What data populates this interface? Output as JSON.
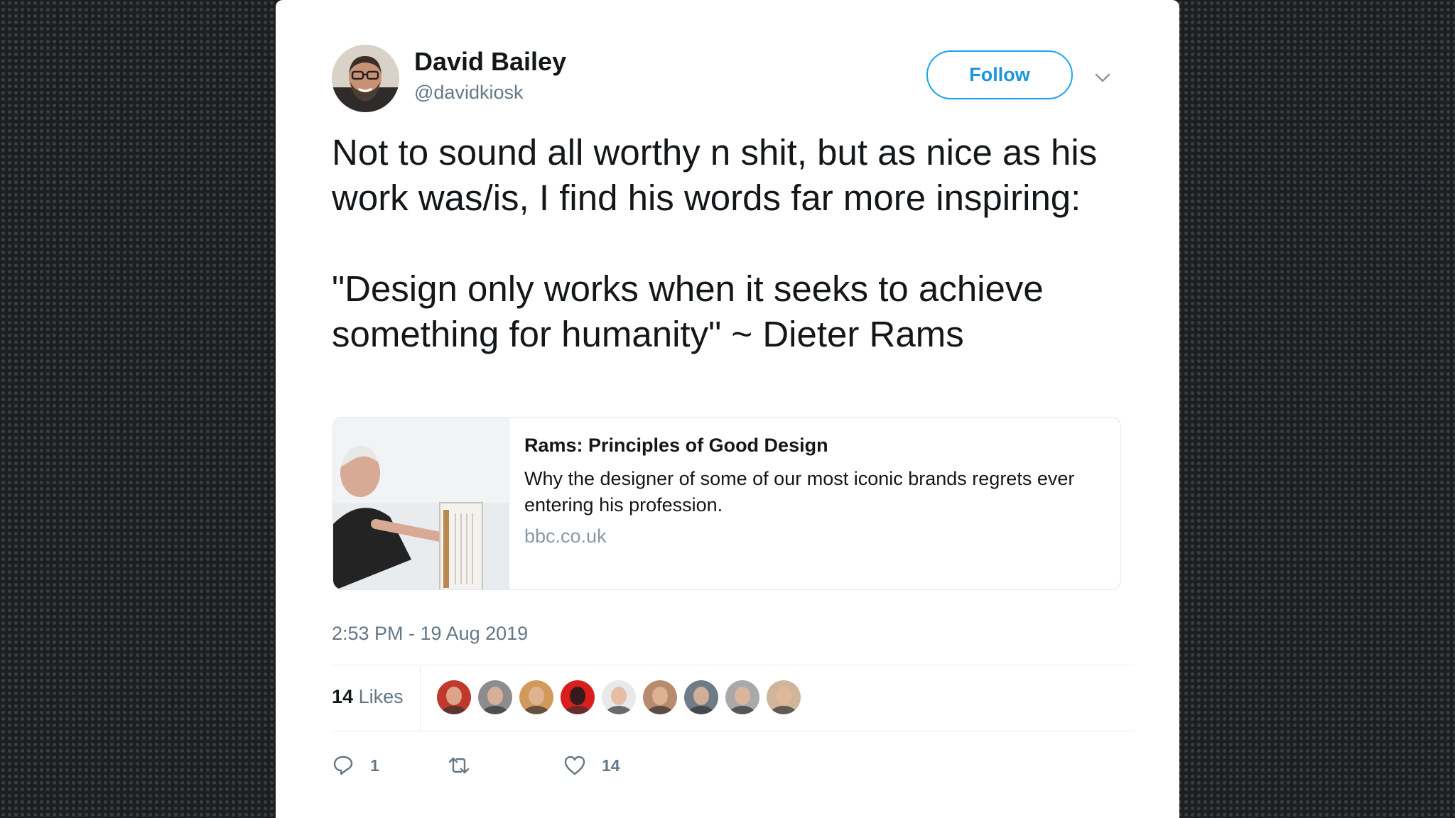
{
  "tweet": {
    "author": {
      "name": "David Bailey",
      "handle": "@davidkiosk"
    },
    "follow_label": "Follow",
    "text_lines": [
      "Not to sound all worthy n shit, but as nice as his work was/is, I find his words far more inspiring:",
      "\"Design only works when it seeks to achieve something for humanity\" ~ Dieter Rams"
    ],
    "link_card": {
      "title": "Rams: Principles of Good Design",
      "description": "Why the designer of some of our most iconic brands regrets ever entering his profession.",
      "domain": "bbc.co.uk"
    },
    "timestamp": "2:53 PM - 19 Aug 2019",
    "likes": {
      "count": "14",
      "label": "Likes"
    },
    "likers": [
      {
        "name": "liker-1",
        "color": "#c0392b"
      },
      {
        "name": "liker-2",
        "color": "#8d8d8d"
      },
      {
        "name": "liker-3",
        "color": "#d19a5b"
      },
      {
        "name": "liker-4",
        "color": "#d91e1e"
      },
      {
        "name": "liker-5",
        "color": "#e9e9e9"
      },
      {
        "name": "liker-6",
        "color": "#b98b6e"
      },
      {
        "name": "liker-7",
        "color": "#6f7b86"
      },
      {
        "name": "liker-8",
        "color": "#a9a9a9"
      },
      {
        "name": "liker-9",
        "color": "#cfb69a"
      }
    ],
    "actions": {
      "reply_count": "1",
      "retweet_count": "",
      "like_count": "14"
    },
    "colors": {
      "accent": "#1da1f2",
      "text": "#14171a",
      "muted": "#657786"
    }
  }
}
